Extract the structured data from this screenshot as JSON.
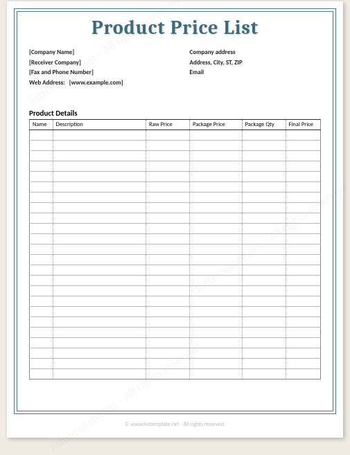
{
  "title": "Product Price List",
  "sender": {
    "company": "[Company Name]",
    "receiver": "[Receiver Company]",
    "fax_phone": "[Fax and Phone Number]",
    "web_label": "Web Address:",
    "web_value": "[www.example.com]"
  },
  "recipient": {
    "address_label": "Company address",
    "address_detail": "Address, City, ST, ZIP",
    "email": "Email"
  },
  "section_title": "Product Details",
  "columns": {
    "name": "Name",
    "description": "Description",
    "raw_price": "Raw Price",
    "package_price": "Package Price",
    "package_qty": "Package Qty",
    "final_price": "Final Price"
  },
  "row_count": 24,
  "footer": "© www.listtemplate.net - All rights reserved.",
  "watermark": "listtemplate.net  - All rights reserved"
}
